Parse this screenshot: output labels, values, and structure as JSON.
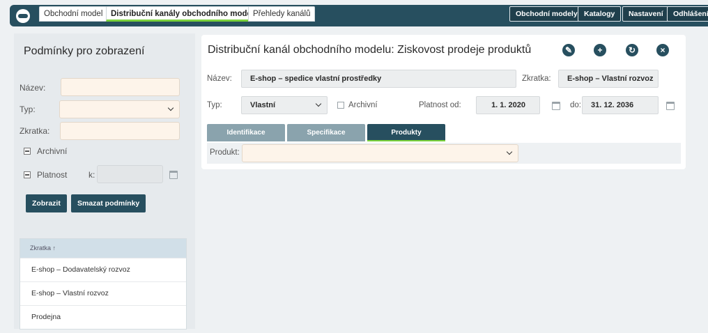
{
  "topbar": {
    "tabs": [
      {
        "label": "Obchodní model"
      },
      {
        "label": "Distribuční kanály obchodního modelu"
      },
      {
        "label": "Přehledy kanálů"
      }
    ],
    "right_buttons": [
      {
        "label": "Obchodní modely"
      },
      {
        "label": "Katalogy"
      },
      {
        "label": "Nastavení"
      },
      {
        "label": "Odhlášení"
      }
    ]
  },
  "filter": {
    "title": "Podmínky pro zobrazení",
    "name_label": "Název:",
    "name_value": "",
    "type_label": "Typ:",
    "type_value": "",
    "code_label": "Zkratka:",
    "code_value": "",
    "archive_label": "Archivní",
    "validity_label": "Platnost",
    "validity_k_label": "k:",
    "show_button": "Zobrazit",
    "clear_button": "Smazat podmínky"
  },
  "list": {
    "header": "Zkratka",
    "sort_icon": "arrow-up",
    "rows": [
      {
        "label": "E-shop – Dodavatelský rozvoz"
      },
      {
        "label": "E-shop – Vlastní rozvoz"
      },
      {
        "label": "Prodejna"
      }
    ]
  },
  "detail": {
    "title": "Distribuční kanál obchodního modelu: Ziskovost prodeje produktů",
    "icons": [
      "edit-icon",
      "add-icon",
      "copy-icon",
      "close-icon"
    ],
    "name_label": "Název:",
    "name_value": "E-shop – spedice vlastní prostředky",
    "code_label": "Zkratka:",
    "code_value": "E-shop – Vlastní rozvoz",
    "type_label": "Typ:",
    "type_value": "Vlastní",
    "archive_label": "Archivní",
    "valid_from_label": "Platnost od:",
    "valid_from_value": "1. 1. 2020",
    "valid_to_label": "do:",
    "valid_to_value": "31. 12. 2036",
    "subtabs": [
      {
        "label": "Identifikace"
      },
      {
        "label": "Specifikace"
      },
      {
        "label": "Produkty"
      }
    ],
    "product_label": "Produkt:",
    "product_value": ""
  },
  "colors": {
    "primary": "#274f5f",
    "accent": "#7ad13b",
    "input_bg": "#fdf4ea"
  }
}
